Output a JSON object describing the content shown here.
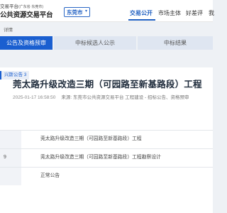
{
  "header": {
    "logo_line1": "交易平台",
    "logo_line1_sub": "(广东省·东莞市)",
    "logo_line2": "公共资源交易平台",
    "city": "东莞市",
    "nav": [
      "交易公开",
      "市场主体",
      "好差评",
      "我"
    ]
  },
  "breadcrumb": "详情",
  "tabs": [
    "公告及资格预审",
    "中标候选人公示",
    "中标结果"
  ],
  "chip": "兴斯公告 3",
  "article": {
    "title": "莞太路升级改造三期（可园路至新基路段）工程",
    "date": "2025-01-17 16:58:50",
    "source": "来源: 东莞市公共资源交易平台 工程建设 - 招标公告、资格预审"
  },
  "table": {
    "rows": [
      {
        "label": "",
        "value": "莞太路升级改造三期（可园路至新基路段）工程"
      },
      {
        "label": "9",
        "value": "莞太路升级改造三期（可园路至新基路段）工程勘察设计"
      },
      {
        "label": "",
        "value": "正常公告"
      }
    ]
  }
}
